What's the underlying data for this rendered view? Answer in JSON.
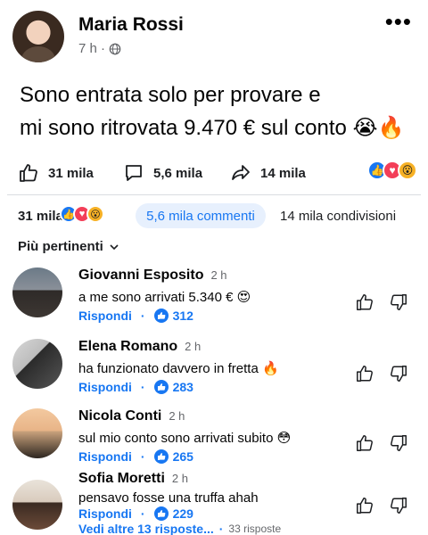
{
  "post": {
    "author": "Maria Rossi",
    "time": "7 h ·",
    "more": "•••",
    "text_line1": "Sono entrata solo per provare e",
    "text_line2": "mi sono ritrovata 9.470 € sul conto 😭🔥"
  },
  "stats": {
    "likes": "31 mila",
    "comments": "5,6 mila",
    "shares": "14 mila",
    "reaction_icons": [
      "like-icon",
      "love-icon",
      "wow-icon"
    ]
  },
  "summary": {
    "reactions": "31 mila",
    "comments": "5,6 mila commenti",
    "shares": "14 mila condivisioni"
  },
  "sort": {
    "label": "Più pertinenti"
  },
  "comments": [
    {
      "name": "Giovanni Esposito",
      "time": "2 h",
      "text": "a me sono arrivati 5.340 € 😍",
      "reply": "Rispondi",
      "dot": "·",
      "likes": "312"
    },
    {
      "name": "Elena Romano",
      "time": "2 h",
      "text": "ha funzionato davvero in fretta 🔥",
      "reply": "Rispondi",
      "dot": "·",
      "likes": "283"
    },
    {
      "name": "Nicola Conti",
      "time": "2 h",
      "text": "sul mio conto sono arrivati subito 😳",
      "reply": "Rispondi",
      "dot": "·",
      "likes": "265"
    },
    {
      "name": "Sofia Moretti",
      "time": "2 h",
      "text": "pensavo fosse una truffa ahah",
      "reply": "Rispondi",
      "dot": "·",
      "likes": "229"
    }
  ],
  "more_replies": {
    "label": "Vedi altre 13 risposte...",
    "dot": "·",
    "count": "33 risposte"
  },
  "colors": {
    "accent": "#1877f2",
    "pill_bg": "#e7f0fd",
    "love": "#f33e58",
    "wow": "#f7b125"
  }
}
